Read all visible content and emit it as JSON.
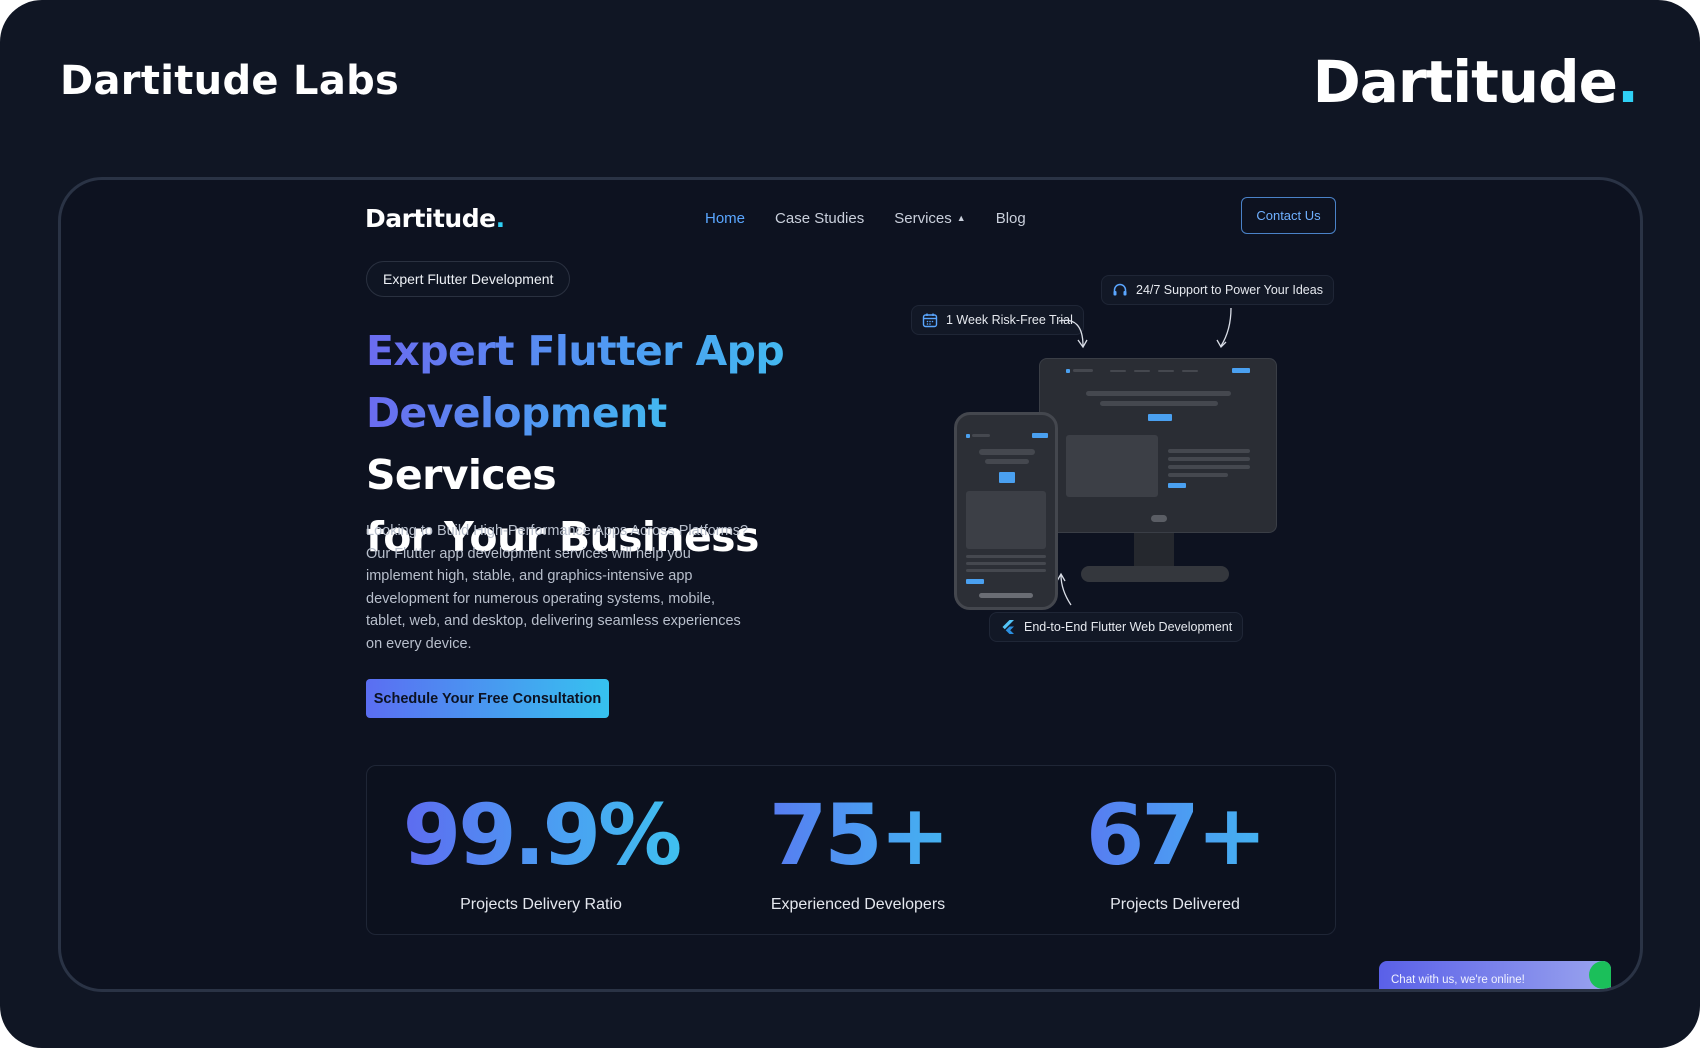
{
  "brand_left": "Dartitude Labs",
  "brand_right": {
    "text": "Dartitude",
    "dot": "."
  },
  "site": {
    "logo": {
      "text": "Dartitude",
      "dot": "."
    },
    "nav": [
      {
        "label": "Home",
        "active": true
      },
      {
        "label": "Case Studies",
        "active": false
      },
      {
        "label": "Services",
        "active": false
      },
      {
        "label": "Blog",
        "active": false
      }
    ],
    "contact_label": "Contact Us"
  },
  "hero": {
    "pill": "Expert Flutter Development",
    "title_gradient_1": "Expert Flutter App",
    "title_gradient_2": "Development",
    "title_white_1": " Services",
    "title_white_2": "for Your Business",
    "description": "Looking to Build High-Performance Apps Across Platforms? Our Flutter app development services will help you implement high, stable, and graphics-intensive app development for numerous operating systems, mobile, tablet, web, and desktop, delivering seamless experiences on every device.",
    "cta": "Schedule Your Free Consultation"
  },
  "illustration": {
    "tag_trial": "1 Week Risk-Free Trial",
    "tag_support": "24/7 Support to Power Your Ideas",
    "tag_web": "End-to-End Flutter Web Development",
    "icons": [
      "calendar-icon",
      "headset-icon",
      "flutter-logo-icon"
    ]
  },
  "stats": [
    {
      "value": "99.9%",
      "label": "Projects Delivery Ratio"
    },
    {
      "value": "75+",
      "label": "Experienced Developers"
    },
    {
      "value": "67+",
      "label": "Projects Delivered"
    }
  ],
  "chat": "Chat with us, we're online!",
  "colors": {
    "background": "#101624",
    "accent_blue": "#4f9bf2",
    "accent_cyan": "#2fd0f5",
    "accent_violet": "#6b6bf0"
  }
}
